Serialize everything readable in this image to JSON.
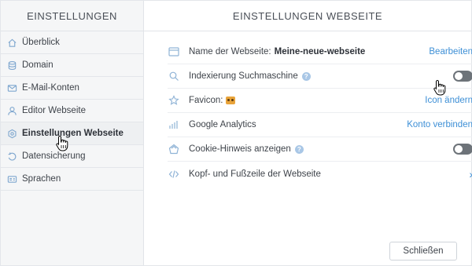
{
  "sidebar": {
    "title": "EINSTELLUNGEN",
    "items": [
      {
        "label": "Überblick",
        "icon": "home-icon"
      },
      {
        "label": "Domain",
        "icon": "database-icon"
      },
      {
        "label": "E-Mail-Konten",
        "icon": "mail-icon"
      },
      {
        "label": "Editor Webseite",
        "icon": "user-icon"
      },
      {
        "label": "Einstellungen Webseite",
        "icon": "gear-icon",
        "active": true
      },
      {
        "label": "Datensicherung",
        "icon": "backup-icon"
      },
      {
        "label": "Sprachen",
        "icon": "language-icon"
      }
    ]
  },
  "main": {
    "title": "EINSTELLUNGEN WEBSEITE",
    "rows": [
      {
        "label": "Name der Webseite:",
        "value": "Meine-neue-webseite",
        "action": "Bearbeiten",
        "icon": "browser-window-icon"
      },
      {
        "label": "Indexierung Suchmaschine",
        "help": "?",
        "toggle": "off",
        "icon": "search-icon"
      },
      {
        "label": "Favicon:",
        "action": "Icon ändern",
        "icon": "star-icon"
      },
      {
        "label": "Google Analytics",
        "action": "Konto verbinden",
        "icon": "bar-chart-icon"
      },
      {
        "label": "Cookie-Hinweis anzeigen",
        "help": "?",
        "toggle": "off",
        "icon": "cookie-icon"
      },
      {
        "label": "Kopf- und Fußzeile der Webseite",
        "action_icon": "chevron-right-icon",
        "icon": "code-icon"
      }
    ],
    "chevron": "›",
    "close_label": "Schließen"
  },
  "colors": {
    "accent": "#3d8fd6",
    "icon": "#8fb3d6",
    "toggle_off": "#6d7379"
  }
}
